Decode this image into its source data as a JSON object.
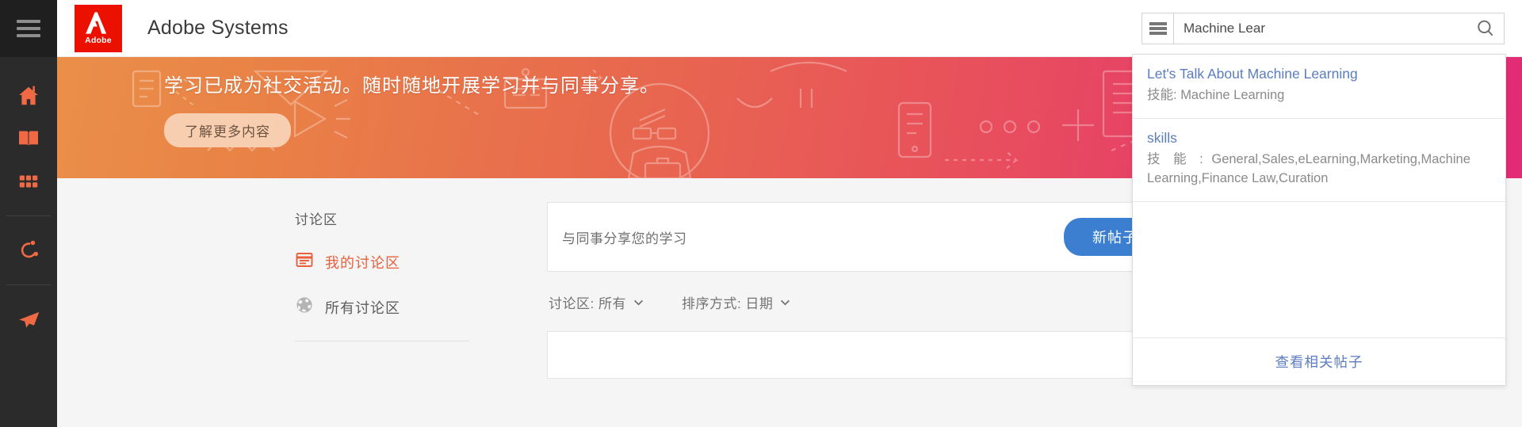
{
  "colors": {
    "rail_bg": "#2b2b2b",
    "rail_icon": "#ef6a44",
    "adobe_red": "#eb1000",
    "banner_from": "#ea8f4a",
    "banner_to": "#e22a76",
    "accent_orange": "#e8603c",
    "primary_blue": "#3c7fd0",
    "link_blue": "#5b7dc0"
  },
  "rail": {
    "menu_icon": "hamburger-icon",
    "items": [
      {
        "id": "home",
        "icon": "home-icon"
      },
      {
        "id": "catalog",
        "icon": "book-icon"
      },
      {
        "id": "apps",
        "icon": "grid-icon"
      },
      {
        "id": "social",
        "icon": "share-network-icon"
      },
      {
        "id": "send",
        "icon": "paper-plane-icon"
      }
    ]
  },
  "header": {
    "logo_mark": "adobe-a-icon",
    "logo_wordmark": "Adobe",
    "org_name": "Adobe Systems",
    "filter_icon": "filter-lines-icon",
    "search": {
      "value": "Machine Lear",
      "placeholder": "",
      "icon": "search-icon"
    }
  },
  "banner": {
    "headline": "学习已成为社交活动。随时随地开展学习并与同事分享。",
    "cta_label": "了解更多内容"
  },
  "main": {
    "discussion": {
      "title": "讨论区",
      "items": [
        {
          "label": "我的讨论区",
          "icon": "board-icon",
          "active": true
        },
        {
          "label": "所有讨论区",
          "icon": "globe-icon",
          "active": false
        }
      ]
    },
    "composer": {
      "placeholder": "与同事分享您的学习",
      "new_post_label": "新帖子"
    },
    "filters": [
      {
        "label": "讨论区: 所有",
        "icon": "chevron-down-icon"
      },
      {
        "label": "排序方式: 日期",
        "icon": "chevron-down-icon"
      }
    ]
  },
  "suggestions": {
    "items": [
      {
        "title": "Let's Talk About Machine Learning",
        "subtitle_key": "技能:",
        "subtitle_value": "Machine Learning"
      },
      {
        "title": "skills",
        "subtitle_key": "技 能 :",
        "subtitle_value": "General,Sales,eLearning,Marketing,Machine Learning,Finance Law,Curation"
      }
    ],
    "footer_label": "查看相关帖子"
  }
}
